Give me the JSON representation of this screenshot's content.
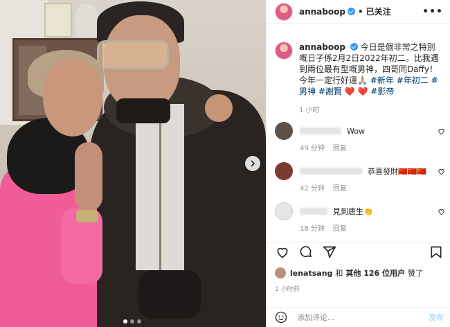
{
  "post": {
    "username": "annaboop",
    "header_sep": "•",
    "follow_status": "已关注",
    "more": "•••",
    "caption": {
      "handle": "annaboop",
      "text": "今日是個非常之特別嘅日子係2月2日2022年初二。比我遇到兩位最有型嘅男神，四哥同Daffy！今年一定行好運🙏🏼",
      "hashtags": [
        "#新年",
        "#年初二",
        "#男神",
        "#謝賢",
        "#影帝"
      ],
      "hearts": "❤️ ❤️",
      "time": "1 小时"
    },
    "comments": [
      {
        "text": "Wow",
        "age": "49 分钟",
        "reply": "回复"
      },
      {
        "text": "恭喜發財🇨🇳🇨🇳🇨🇳",
        "age": "42 分钟",
        "reply": "回复"
      },
      {
        "text": "見到唐生👏",
        "age": "18 分钟",
        "reply": "回复"
      }
    ],
    "likes": {
      "first_user": "lenatsang",
      "connector": "和",
      "others": "其他 126 位用户",
      "suffix": "赞了"
    },
    "posted": "1 小时前",
    "comment_input": {
      "placeholder": "添加评论...",
      "post_label": "发布"
    }
  },
  "icons": {
    "like": "heart-icon",
    "comment": "comment-icon",
    "share": "share-icon",
    "save": "bookmark-icon",
    "emoji": "emoji-icon",
    "carousel": "chevron-right-icon"
  },
  "colors": {
    "verified": "#3897f0",
    "hashtag": "#00376b",
    "heart": "#ed4956",
    "muted": "#8e8e8e"
  }
}
